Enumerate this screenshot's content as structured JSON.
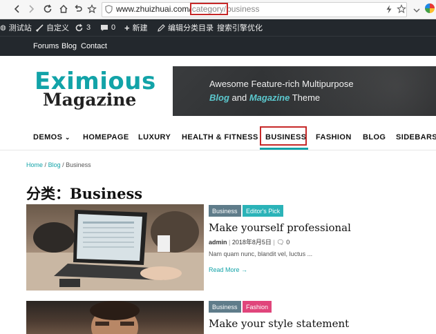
{
  "browser": {
    "url_domain": "www.zhuizhuai.com/",
    "url_path_highlight": "category/",
    "url_path_rest": "business"
  },
  "adminbar": {
    "site": "测试站",
    "customize": "自定义",
    "updates": "3",
    "comments": "0",
    "new": "新建",
    "edit_category": "编辑分类目录",
    "seo": "搜索引擎优化"
  },
  "topnav": {
    "items": [
      "Forums",
      "Blog",
      "Contact"
    ]
  },
  "header": {
    "logo_line1": "Eximious",
    "logo_line2": "Magazine",
    "banner_line1": "Awesome Feature-rich Multipurpose",
    "banner_blog": "Blog",
    "banner_and": " and ",
    "banner_magazine": "Magazine",
    "banner_theme": " Theme"
  },
  "menu": {
    "demos": "DEMOS",
    "homepage": "HOMEPAGE",
    "luxury": "LUXURY",
    "health": "HEALTH & FITNESS",
    "business": "BUSINESS",
    "fashion": "FASHION",
    "blog": "BLOG",
    "sidebars": "SIDEBARS"
  },
  "breadcrumb": {
    "home": "Home",
    "sep": "/",
    "blog": "Blog",
    "current": "Business"
  },
  "page_title": "分类：Business",
  "posts": [
    {
      "badges": [
        {
          "label": "Business",
          "color": "#5f7c8a"
        },
        {
          "label": "Editor's Pick",
          "color": "#2bb3b8"
        }
      ],
      "title": "Make yourself professional",
      "author": "admin",
      "date": "2018年8月5日",
      "comments": "0",
      "excerpt": "Nam quam nunc, blandit vel, luctus ...",
      "read_more": "Read More →"
    },
    {
      "badges": [
        {
          "label": "Business",
          "color": "#5f7c8a"
        },
        {
          "label": "Fashion",
          "color": "#e0457b"
        }
      ],
      "title": "Make your style statement"
    }
  ]
}
